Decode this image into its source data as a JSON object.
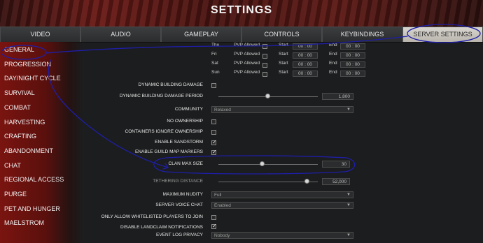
{
  "header": {
    "title": "SETTINGS"
  },
  "tabs": [
    {
      "label": "VIDEO"
    },
    {
      "label": "AUDIO"
    },
    {
      "label": "GAMEPLAY"
    },
    {
      "label": "CONTROLS"
    },
    {
      "label": "KEYBINDINGS"
    },
    {
      "label": "SERVER SETTINGS",
      "active": true
    }
  ],
  "sidebar": {
    "items": [
      {
        "label": "GENERAL"
      },
      {
        "label": "PROGRESSION"
      },
      {
        "label": "DAY/NIGHT CYCLE"
      },
      {
        "label": "SURVIVAL"
      },
      {
        "label": "COMBAT"
      },
      {
        "label": "HARVESTING"
      },
      {
        "label": "CRAFTING"
      },
      {
        "label": "ABANDONMENT"
      },
      {
        "label": "CHAT"
      },
      {
        "label": "REGIONAL ACCESS"
      },
      {
        "label": "PURGE"
      },
      {
        "label": "PET AND HUNGER"
      },
      {
        "label": "MAELSTROM"
      }
    ]
  },
  "pvp_schedule": {
    "pvp_label": "PVP Allowed",
    "start_label": "Start",
    "end_label": "End",
    "rows": [
      {
        "day": "Thu",
        "start": "00 : 00",
        "end": "00 : 00"
      },
      {
        "day": "Fri",
        "start": "00 : 00",
        "end": "00 : 00"
      },
      {
        "day": "Sat",
        "start": "00 : 00",
        "end": "00 : 00"
      },
      {
        "day": "Sun",
        "start": "00 : 00",
        "end": "00 : 00"
      }
    ]
  },
  "settings": {
    "dynamic_building_damage": {
      "label": "DYNAMIC BUILDING DAMAGE",
      "checked": false
    },
    "dynamic_building_damage_period": {
      "label": "DYNAMIC BUILDING DAMAGE PERIOD",
      "value": "1,800",
      "slider_fraction": 0.5
    },
    "community": {
      "label": "COMMUNITY",
      "value": "Relaxed"
    },
    "no_ownership": {
      "label": "NO OWNERSHIP",
      "checked": false
    },
    "containers_ignore_ownership": {
      "label": "CONTAINERS IGNORE OWNERSHIP",
      "checked": false
    },
    "enable_sandstorm": {
      "label": "ENABLE SANDSTORM",
      "checked": true
    },
    "enable_guild_map_markers": {
      "label": "ENABLE GUILD MAP MARKERS",
      "checked": true
    },
    "clan_max_size": {
      "label": "CLAN MAX SIZE",
      "value": "30",
      "slider_fraction": 0.45
    },
    "tethering_distance": {
      "label": "TETHERING DISTANCE",
      "value": "52,000",
      "slider_fraction": 0.92
    },
    "maximum_nudity": {
      "label": "MAXIMUM NUDITY",
      "value": "Full"
    },
    "server_voice_chat": {
      "label": "SERVER VOICE CHAT",
      "value": "Enabled"
    },
    "only_allow_whitelisted": {
      "label": "ONLY ALLOW WHITELISTED PLAYERS TO JOIN",
      "checked": false
    },
    "disable_landclaim_notifications": {
      "label": "DISABLE LANDCLAIM NOTIFICATIONS",
      "checked": true
    },
    "event_log_privacy": {
      "label": "EVENT LOG PRIVACY",
      "value": "Nobody"
    }
  },
  "colors": {
    "header_red": "#6a1b17",
    "sidebar_red": "#7a1410",
    "active_tab": "#c9c5bd",
    "annotation_ink": "#1e1ea8"
  }
}
